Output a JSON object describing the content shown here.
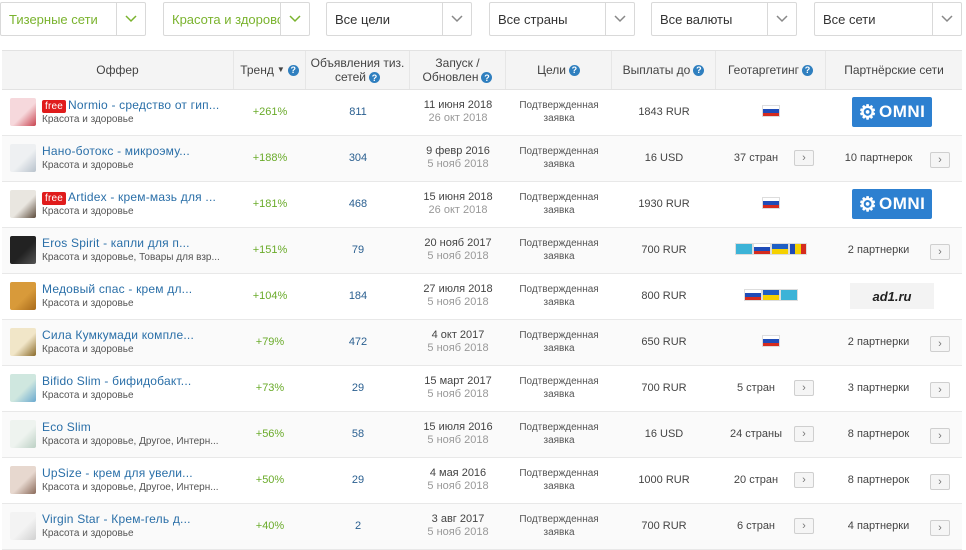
{
  "filters": [
    {
      "label": "Тизерные сети",
      "active": true
    },
    {
      "label": "Красота и здорово...",
      "active": true
    },
    {
      "label": "Все цели",
      "active": false
    },
    {
      "label": "Все страны",
      "active": false
    },
    {
      "label": "Все валюты",
      "active": false
    },
    {
      "label": "Все сети",
      "active": false
    }
  ],
  "columns": {
    "offer": "Оффер",
    "trend": "Тренд",
    "ads_line1": "Объявления тиз.",
    "ads_line2": "сетей",
    "launch_line1": "Запуск /",
    "launch_line2": "Обновлен",
    "goals": "Цели",
    "payouts": "Выплаты до",
    "geo": "Геотаргетинг",
    "partners": "Партнёрские сети"
  },
  "rows": [
    {
      "free": "free",
      "title": "Normio - средство от гип...",
      "category": "Красота и здоровье",
      "trend": "+261%",
      "ads": "811",
      "launch": "11 июня 2018",
      "updated": "26 окт 2018",
      "goal1": "Подтвержденная",
      "goal2": "заявка",
      "payout": "1843 RUR",
      "geo": {
        "flags": [
          "ru"
        ]
      },
      "partner": {
        "logo": "OMNI"
      }
    },
    {
      "free": "",
      "title": "Нано-ботокс - микроэму...",
      "category": "Красота и здоровье",
      "trend": "+188%",
      "ads": "304",
      "launch": "9 февр 2016",
      "updated": "5 нояб 2018",
      "goal1": "Подтвержденная",
      "goal2": "заявка",
      "payout": "16 USD",
      "geo": {
        "text": "37 стран"
      },
      "partner": {
        "text": "10 партнерок"
      }
    },
    {
      "free": "free",
      "title": "Artidex - крем-мазь для ...",
      "category": "Красота и здоровье",
      "trend": "+181%",
      "ads": "468",
      "launch": "15 июня 2018",
      "updated": "26 окт 2018",
      "goal1": "Подтвержденная",
      "goal2": "заявка",
      "payout": "1930 RUR",
      "geo": {
        "flags": [
          "ru"
        ]
      },
      "partner": {
        "logo": "OMNI"
      }
    },
    {
      "free": "",
      "title": "Eros Spirit - капли для п...",
      "category": "Красота и здоровье, Товары для взр...",
      "trend": "+151%",
      "ads": "79",
      "launch": "20 нояб 2017",
      "updated": "5 нояб 2018",
      "goal1": "Подтвержденная",
      "goal2": "заявка",
      "payout": "700 RUR",
      "geo": {
        "flags": [
          "kz",
          "ru",
          "ua",
          "md"
        ]
      },
      "partner": {
        "text": "2 партнерки"
      }
    },
    {
      "free": "",
      "title": "Медовый спас - крем дл...",
      "category": "Красота и здоровье",
      "trend": "+104%",
      "ads": "184",
      "launch": "27 июля 2018",
      "updated": "5 нояб 2018",
      "goal1": "Подтвержденная",
      "goal2": "заявка",
      "payout": "800 RUR",
      "geo": {
        "flags": [
          "ru",
          "ua",
          "kz"
        ]
      },
      "partner": {
        "logo_ad1": "ad1.ru"
      }
    },
    {
      "free": "",
      "title": "Сила Кумкумади компле...",
      "category": "Красота и здоровье",
      "trend": "+79%",
      "ads": "472",
      "launch": "4 окт 2017",
      "updated": "5 нояб 2018",
      "goal1": "Подтвержденная",
      "goal2": "заявка",
      "payout": "650 RUR",
      "geo": {
        "flags": [
          "ru"
        ]
      },
      "partner": {
        "text": "2 партнерки"
      }
    },
    {
      "free": "",
      "title": "Bifido Slim - бифидобакт...",
      "category": "Красота и здоровье",
      "trend": "+73%",
      "ads": "29",
      "launch": "15 март 2017",
      "updated": "5 нояб 2018",
      "goal1": "Подтвержденная",
      "goal2": "заявка",
      "payout": "700 RUR",
      "geo": {
        "text": "5 стран"
      },
      "partner": {
        "text": "3 партнерки"
      }
    },
    {
      "free": "",
      "title": "Eco Slim",
      "category": "Красота и здоровье, Другое, Интерн...",
      "trend": "+56%",
      "ads": "58",
      "launch": "15 июля 2016",
      "updated": "5 нояб 2018",
      "goal1": "Подтвержденная",
      "goal2": "заявка",
      "payout": "16 USD",
      "geo": {
        "text": "24 страны"
      },
      "partner": {
        "text": "8 партнерок"
      }
    },
    {
      "free": "",
      "title": "UpSize - крем для увели...",
      "category": "Красота и здоровье, Другое, Интерн...",
      "trend": "+50%",
      "ads": "29",
      "launch": "4 мая 2016",
      "updated": "5 нояб 2018",
      "goal1": "Подтвержденная",
      "goal2": "заявка",
      "payout": "1000 RUR",
      "geo": {
        "text": "20 стран"
      },
      "partner": {
        "text": "8 партнерок"
      }
    },
    {
      "free": "",
      "title": "Virgin Star - Крем-гель д...",
      "category": "Красота и здоровье",
      "trend": "+40%",
      "ads": "2",
      "launch": "3 авг 2017",
      "updated": "5 нояб 2018",
      "goal1": "Подтвержденная",
      "goal2": "заявка",
      "payout": "700 RUR",
      "geo": {
        "text": "6 стран"
      },
      "partner": {
        "text": "4 партнерки"
      }
    }
  ],
  "colors": {
    "accent_green": "#7ab32e",
    "link_blue": "#2a6fa8",
    "omni_blue": "#2d80d0",
    "free_red": "#e01c1c"
  }
}
